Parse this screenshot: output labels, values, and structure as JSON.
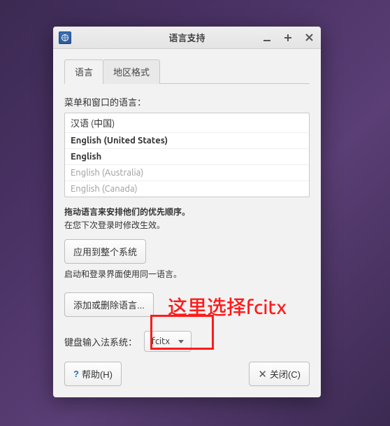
{
  "window": {
    "title": "语言支持"
  },
  "tabs": {
    "language": "语言",
    "regional": "地区格式"
  },
  "menu_lang_label": "菜单和窗口的语言：",
  "lang_list": [
    {
      "label": "汉语 (中国)",
      "bold": false,
      "dim": false
    },
    {
      "label": "English (United States)",
      "bold": true,
      "dim": false
    },
    {
      "label": "English",
      "bold": true,
      "dim": false
    },
    {
      "label": "English (Australia)",
      "bold": false,
      "dim": true
    },
    {
      "label": "English (Canada)",
      "bold": false,
      "dim": true
    }
  ],
  "hints": {
    "drag": "拖动语言来安排他们的优先顺序。",
    "relogin": "在您下次登录时修改生效。",
    "apply_system": "应用到整个系统",
    "startup_login": "启动和登录界面使用同一语言。",
    "add_remove": "添加或删除语言..."
  },
  "ime": {
    "label": "键盘输入法系统：",
    "value": "fcitx"
  },
  "footer": {
    "help": "帮助(H)",
    "close": "关闭(C)"
  },
  "annotation": {
    "text": "这里选择fcitx"
  }
}
